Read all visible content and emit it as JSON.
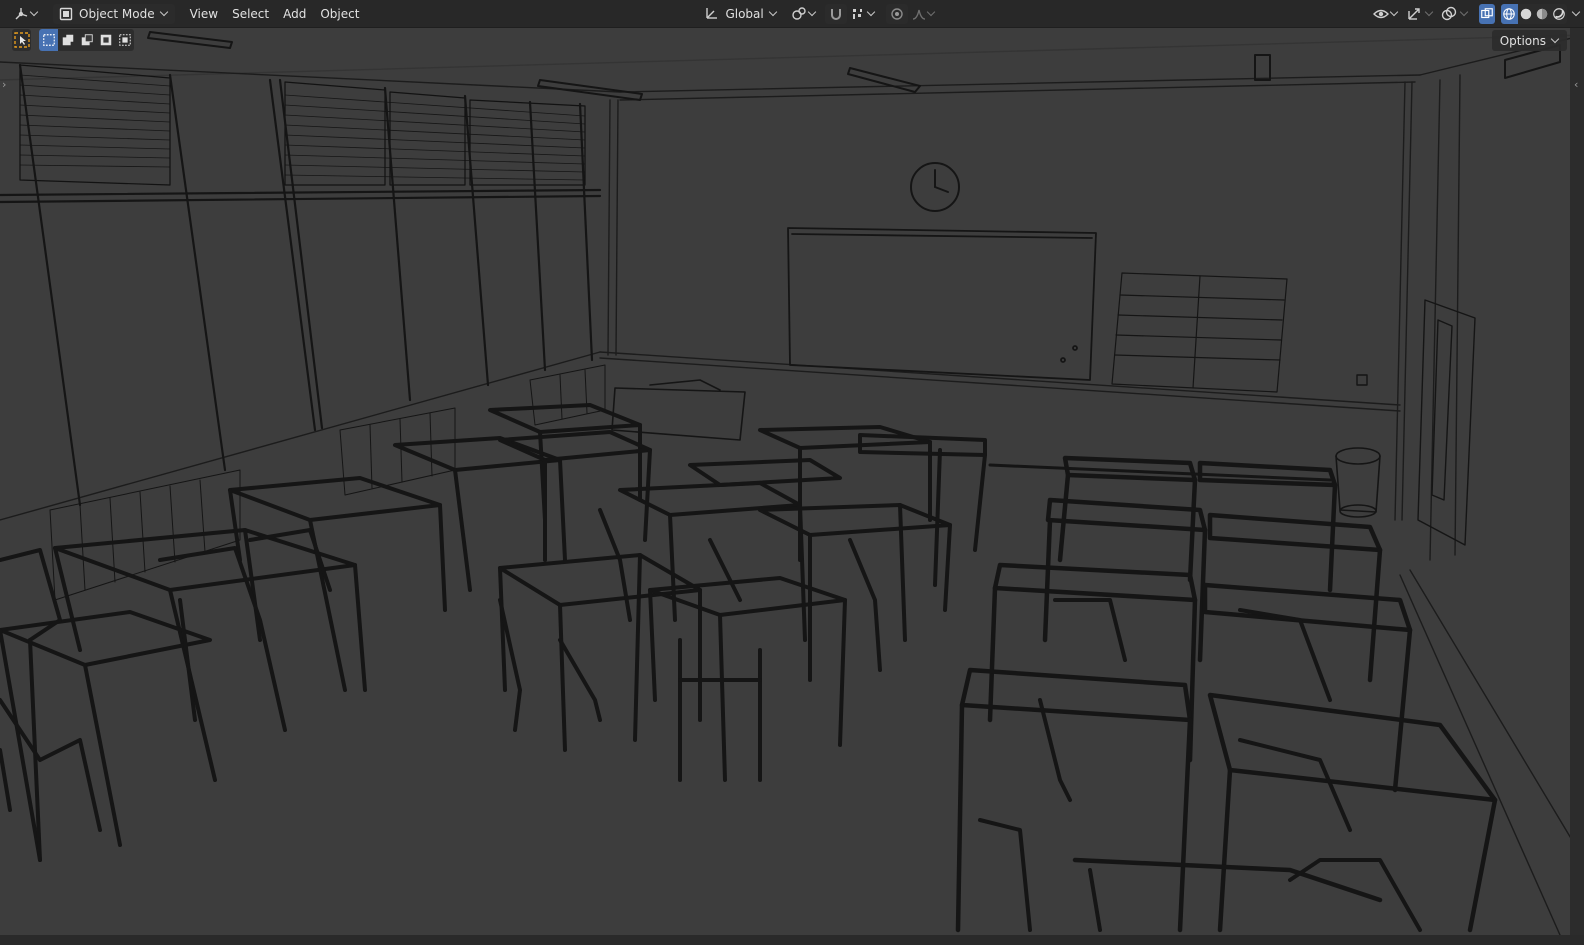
{
  "header": {
    "editor_type_icon": "view3d-editor-icon",
    "mode": {
      "label": "Object Mode",
      "icon": "object-mode-icon"
    },
    "menus": [
      "View",
      "Select",
      "Add",
      "Object"
    ],
    "transform_orientation": {
      "label": "Global",
      "icon": "orientation-axes-icon"
    },
    "pivot_icon": "pivot-point-icon",
    "snap_icon": "snap-magnet-icon",
    "snap_target_icon": "snap-increment-icon",
    "proportional_icon": "proportional-editing-icon",
    "falloff_icon": "falloff-curve-icon",
    "right_icons": [
      "visibility-eye-icon",
      "gizmo-icon",
      "overlay-icon",
      "xray-icon"
    ],
    "shading_modes": [
      "wireframe",
      "solid",
      "material-preview",
      "rendered"
    ],
    "active_shading": "wireframe"
  },
  "toolbar": {
    "select_tool_icon": "select-box-cursor-icon",
    "select_modes": [
      "set-selection",
      "extend-selection",
      "subtract-selection",
      "invert-selection",
      "intersect-selection"
    ],
    "active_select_mode": "set-selection"
  },
  "options": {
    "label": "Options"
  },
  "colors": {
    "header_bg": "#262626",
    "viewport_bg": "#3d3d3d",
    "wire": "#111111",
    "active_blue": "#4772b3",
    "tool_active": "#e49c1f"
  }
}
